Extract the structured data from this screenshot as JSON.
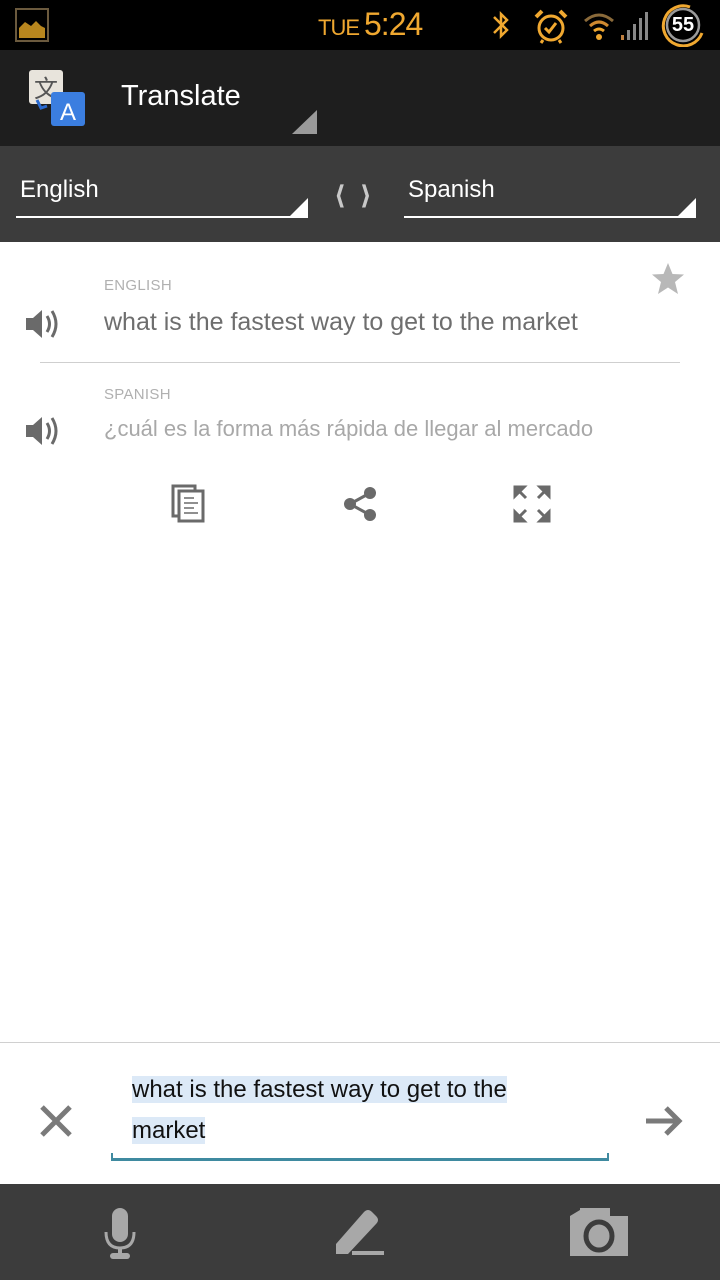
{
  "status_bar": {
    "day": "TUE",
    "time": "5:24",
    "battery_level": "55",
    "icons": [
      "gallery-notification-icon",
      "bluetooth-icon",
      "alarm-icon",
      "wifi-icon",
      "signal-icon",
      "battery-icon"
    ],
    "accent_color": "#f0a830"
  },
  "action_bar": {
    "title": "Translate",
    "icon": "google-translate-icon"
  },
  "language_bar": {
    "source_language": "English",
    "target_language": "Spanish",
    "swap_icon": "swap-languages-icon"
  },
  "translation": {
    "source_caption": "ENGLISH",
    "source_text": "what is the fastest way to get to the market",
    "target_caption": "SPANISH",
    "target_text": "¿cuál es la forma más rápida de llegar al mercado",
    "actions": [
      {
        "name": "copy",
        "icon": "copy-icon"
      },
      {
        "name": "share",
        "icon": "share-icon"
      },
      {
        "name": "fullscreen",
        "icon": "fullscreen-icon"
      }
    ],
    "star_icon": "star-icon"
  },
  "input": {
    "value": "what is the fastest way to get to the market",
    "line1": "what is the fastest way to get to the",
    "line2": "market",
    "clear_icon": "close-icon",
    "submit_icon": "arrow-right-icon",
    "selection_color": "#dce9f7",
    "underline_color": "#3f8aa0"
  },
  "bottom_toolbar": {
    "items": [
      {
        "name": "voice",
        "icon": "microphone-icon"
      },
      {
        "name": "handwriting",
        "icon": "pencil-icon"
      },
      {
        "name": "camera",
        "icon": "camera-icon"
      }
    ]
  }
}
